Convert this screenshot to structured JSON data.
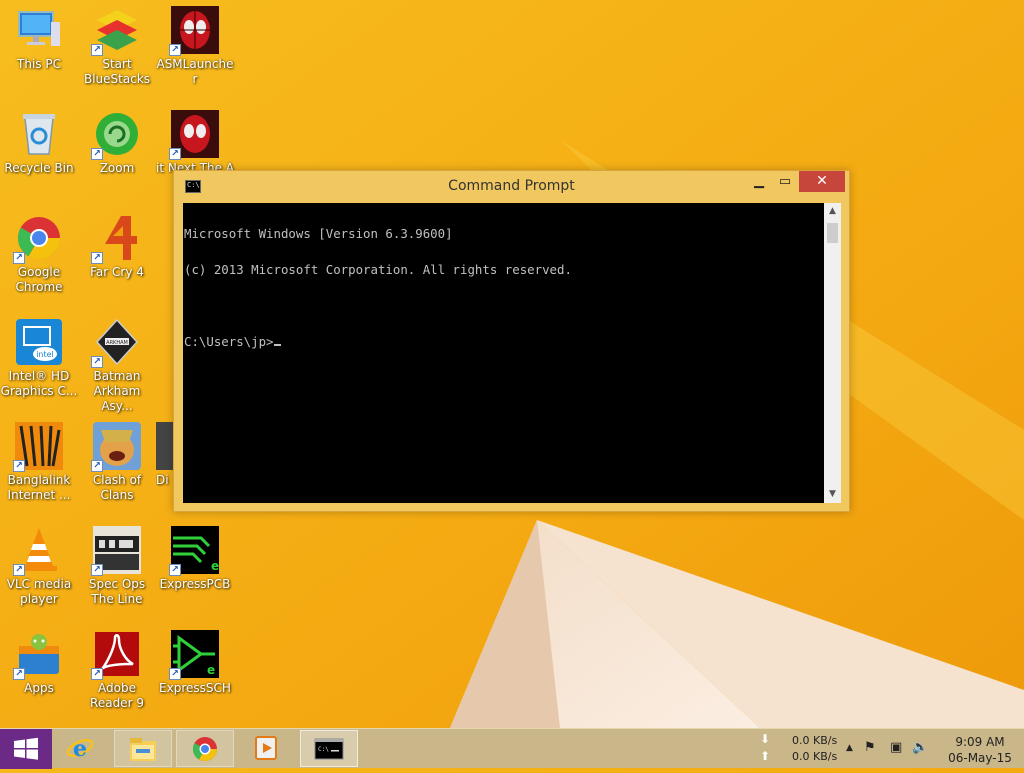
{
  "desktop": {
    "icons": [
      {
        "label": "This PC",
        "icon": "this-pc-icon"
      },
      {
        "label": "Start BlueStacks",
        "icon": "bluestacks-icon"
      },
      {
        "label": "ASMLauncher",
        "icon": "asmlauncher-icon"
      },
      {
        "label": "Recycle Bin",
        "icon": "recycle-bin-icon"
      },
      {
        "label": "Zoom",
        "icon": "zoom-icon"
      },
      {
        "label": "it Next The A",
        "icon": "spiderman-icon"
      },
      {
        "label": "Google Chrome",
        "icon": "chrome-icon"
      },
      {
        "label": "Far Cry 4",
        "icon": "far-cry-4-icon"
      },
      {
        "label": "Intel® HD Graphics C...",
        "icon": "intel-graphics-icon"
      },
      {
        "label": "Batman Arkham Asy...",
        "icon": "batman-arkham-icon"
      },
      {
        "label": "Banglalink Internet ...",
        "icon": "banglalink-icon"
      },
      {
        "label": "Clash of Clans",
        "icon": "clash-of-clans-icon"
      },
      {
        "label": "Di",
        "icon": "partial-icon"
      },
      {
        "label": "VLC media player",
        "icon": "vlc-icon"
      },
      {
        "label": "Spec Ops The Line",
        "icon": "spec-ops-icon"
      },
      {
        "label": "ExpressPCB",
        "icon": "expresspcb-icon"
      },
      {
        "label": "Apps",
        "icon": "apps-icon"
      },
      {
        "label": "Adobe Reader 9",
        "icon": "adobe-reader-icon"
      },
      {
        "label": "ExpressSCH",
        "icon": "expresssch-icon"
      }
    ]
  },
  "window": {
    "title": "Command Prompt",
    "minimize": "▁",
    "maximize": "▭",
    "close": "✕",
    "console_lines": [
      "Microsoft Windows [Version 6.3.9600]",
      "(c) 2013 Microsoft Corporation. All rights reserved.",
      "",
      "C:\\Users\\jp>"
    ],
    "scroll_up": "▲",
    "scroll_down": "▼"
  },
  "taskbar": {
    "apps": [
      {
        "name": "internet-explorer",
        "icon": "internet-explorer-icon"
      },
      {
        "name": "file-explorer",
        "icon": "file-explorer-icon"
      },
      {
        "name": "google-chrome",
        "icon": "chrome-icon"
      },
      {
        "name": "media-player",
        "icon": "media-player-icon"
      },
      {
        "name": "command-prompt",
        "icon": "command-prompt-icon"
      }
    ],
    "tray": {
      "download_speed": "0.0 KB/s",
      "upload_speed": "0.0 KB/s",
      "time": "9:09 AM",
      "date": "06-May-15"
    }
  }
}
